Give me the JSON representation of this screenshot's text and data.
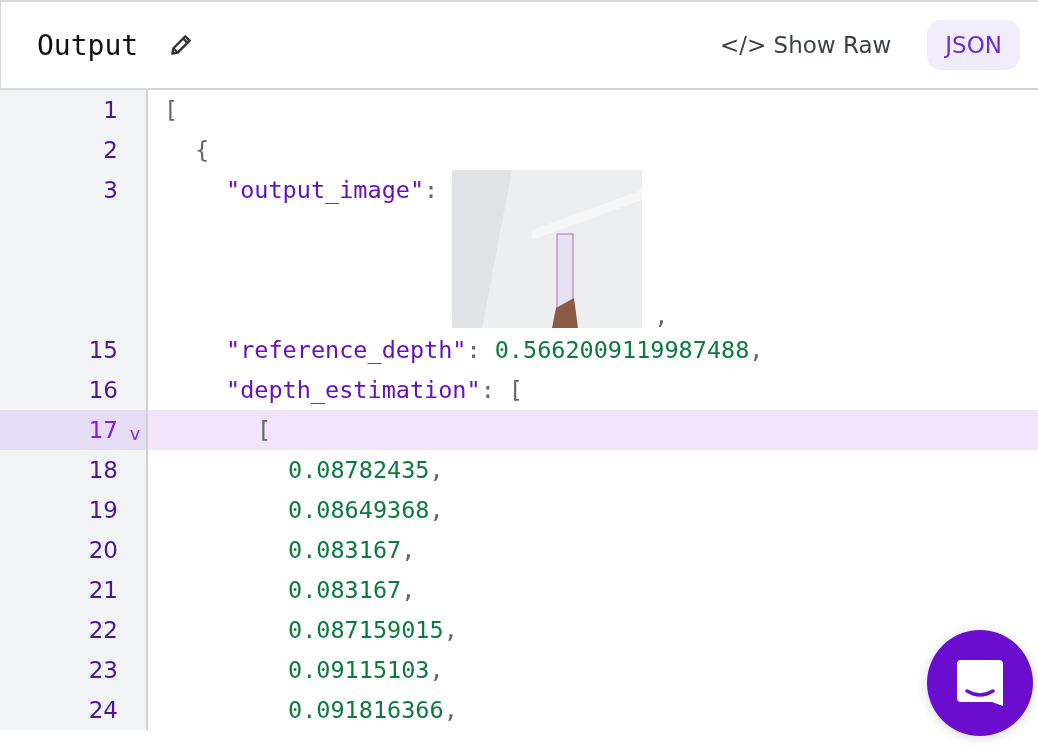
{
  "header": {
    "title": "Output",
    "show_raw": "</> Show Raw",
    "format_button": {
      "label": "JSON",
      "selected": true
    }
  },
  "lines": [
    {
      "number": "1",
      "selected": false,
      "tokens": [
        {
          "kind": "punct",
          "text": "["
        }
      ],
      "children": [
        {
          "number": "2",
          "selected": false,
          "tokens": [
            {
              "kind": "punct",
              "text": "{"
            }
          ],
          "children": [
            {
              "number": "3",
              "selected": false,
              "kind": "image",
              "tokens": [
                {
                  "kind": "key",
                  "text": "\"output_image\""
                },
                {
                  "kind": "punct",
                  "text": ":"
                }
              ],
              "after": ","
            },
            {
              "number": "15",
              "selected": false,
              "tokens": [
                {
                  "kind": "key",
                  "text": "\"reference_depth\""
                },
                {
                  "kind": "punct",
                  "text": ":"
                },
                {
                  "kind": "number",
                  "text": "0.5662009119987488"
                },
                {
                  "kind": "punct",
                  "text": ","
                }
              ]
            },
            {
              "number": "16",
              "selected": false,
              "tokens": [
                {
                  "kind": "key",
                  "text": "\"depth_estimation\""
                },
                {
                  "kind": "punct",
                  "text": ":"
                },
                {
                  "kind": "punct",
                  "text": "["
                }
              ],
              "children": [
                {
                  "number": "17",
                  "selected": true,
                  "fold": "v",
                  "tokens": [
                    {
                      "kind": "punct",
                      "text": "["
                    }
                  ],
                  "children": [
                    {
                      "number": "18",
                      "selected": false,
                      "tokens": [
                        {
                          "kind": "number",
                          "text": "0.08782435"
                        },
                        {
                          "kind": "punct",
                          "text": ","
                        }
                      ]
                    },
                    {
                      "number": "19",
                      "selected": false,
                      "tokens": [
                        {
                          "kind": "number",
                          "text": "0.08649368"
                        },
                        {
                          "kind": "punct",
                          "text": ","
                        }
                      ]
                    },
                    {
                      "number": "20",
                      "selected": false,
                      "tokens": [
                        {
                          "kind": "number",
                          "text": "0.083167"
                        },
                        {
                          "kind": "punct",
                          "text": ","
                        }
                      ]
                    },
                    {
                      "number": "21",
                      "selected": false,
                      "tokens": [
                        {
                          "kind": "number",
                          "text": "0.083167"
                        },
                        {
                          "kind": "punct",
                          "text": ","
                        }
                      ]
                    },
                    {
                      "number": "22",
                      "selected": false,
                      "tokens": [
                        {
                          "kind": "number",
                          "text": "0.087159015"
                        },
                        {
                          "kind": "punct",
                          "text": ","
                        }
                      ]
                    },
                    {
                      "number": "23",
                      "selected": false,
                      "tokens": [
                        {
                          "kind": "number",
                          "text": "0.09115103"
                        },
                        {
                          "kind": "punct",
                          "text": ","
                        }
                      ]
                    },
                    {
                      "number": "24",
                      "selected": false,
                      "tokens": [
                        {
                          "kind": "number",
                          "text": "0.091816366"
                        },
                        {
                          "kind": "punct",
                          "text": ","
                        }
                      ]
                    }
                  ]
                }
              ]
            }
          ]
        }
      ]
    }
  ]
}
